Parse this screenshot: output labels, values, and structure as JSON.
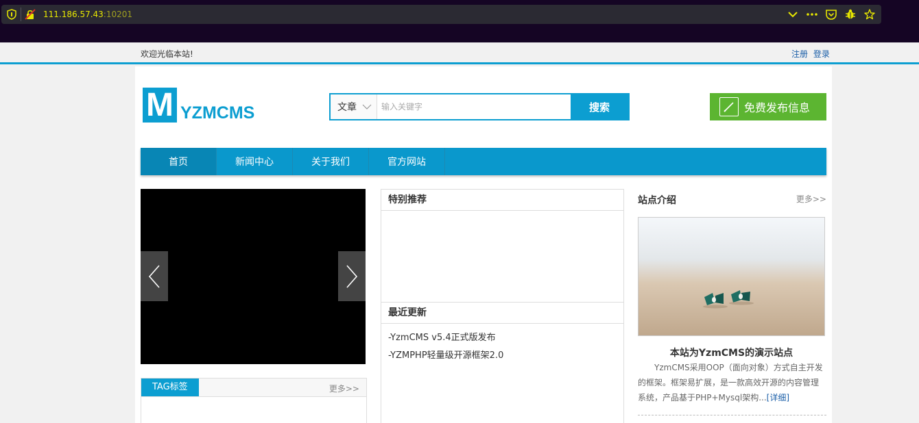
{
  "browser": {
    "url_host": "111.186.57.43",
    "url_port": ":10201",
    "icons": [
      "shield-icon",
      "insecure-lock-icon",
      "chevron-down-icon",
      "more-icon",
      "pocket-icon",
      "extension-icon",
      "bookmark-star-icon"
    ]
  },
  "topbar": {
    "welcome": "欢迎光临本站!",
    "register": "注册",
    "login": "登录"
  },
  "header": {
    "logo_letter": "M",
    "logo_text": "YZMCMS",
    "search": {
      "category": "文章",
      "placeholder": "输入关键字",
      "button": "搜索"
    },
    "publish_button": "免费发布信息"
  },
  "nav": {
    "items": [
      {
        "label": "首页",
        "active": true
      },
      {
        "label": "新闻中心"
      },
      {
        "label": "关于我们"
      },
      {
        "label": "官方网站"
      }
    ]
  },
  "slider": {
    "prev": "‹",
    "next": "›"
  },
  "tags": {
    "title": "TAG标签",
    "more": "更多>>"
  },
  "featured": {
    "title": "特别推荐"
  },
  "recent": {
    "title": "最近更新",
    "items": [
      "-YzmCMS v5.4正式版发布",
      "-YZMPHP轻量级开源框架2.0"
    ]
  },
  "about": {
    "title": "站点介绍",
    "more": "更多>>",
    "photo_title": "本站为YzmCMS的演示站点",
    "description": "YzmCMS采用OOP（面向对象）方式自主开发的框架。框架易扩展，是一款高效开源的内容管理系统，产品基于PHP+Mysql架构...",
    "detail_link": "[详细]"
  },
  "colors": {
    "primary": "#0c9ed1",
    "publish": "#5cb531",
    "link": "#1a5ea8"
  }
}
